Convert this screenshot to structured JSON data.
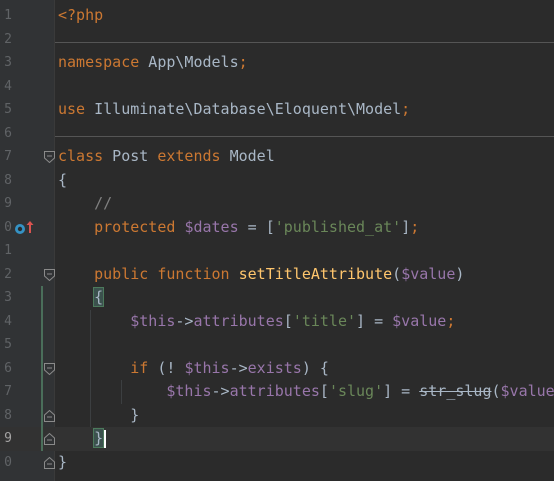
{
  "editor": {
    "colors": {
      "background": "#2b2b2b",
      "gutter": "#313335",
      "keyword": "#cc7832",
      "variable": "#9876aa",
      "string": "#6a8759",
      "comment": "#808080",
      "function": "#ffc66d",
      "plain": "#a9b7c6"
    },
    "lines": [
      {
        "num": "1",
        "tokens": [
          {
            "t": "<?php",
            "c": "kw"
          }
        ]
      },
      {
        "num": "2",
        "tokens": []
      },
      {
        "num": "3",
        "tokens": [
          {
            "t": "namespace",
            "c": "kw"
          },
          {
            "t": " App\\Models",
            "c": "plain"
          },
          {
            "t": ";",
            "c": "kw"
          }
        ]
      },
      {
        "num": "4",
        "tokens": []
      },
      {
        "num": "5",
        "tokens": [
          {
            "t": "use",
            "c": "kw"
          },
          {
            "t": " Illuminate\\Database\\Eloquent\\Model",
            "c": "plain"
          },
          {
            "t": ";",
            "c": "kw"
          }
        ]
      },
      {
        "num": "6",
        "tokens": []
      },
      {
        "num": "7",
        "tokens": [
          {
            "t": "class",
            "c": "kw"
          },
          {
            "t": " Post ",
            "c": "plain"
          },
          {
            "t": "extends",
            "c": "kw"
          },
          {
            "t": " Model",
            "c": "plain"
          }
        ]
      },
      {
        "num": "8",
        "tokens": [
          {
            "t": "{",
            "c": "plain"
          }
        ]
      },
      {
        "num": "9",
        "tokens": [
          {
            "t": "    ",
            "c": "plain"
          },
          {
            "t": "//",
            "c": "cmt"
          }
        ]
      },
      {
        "num": "0",
        "tokens": [
          {
            "t": "    ",
            "c": "plain"
          },
          {
            "t": "protected",
            "c": "kw"
          },
          {
            "t": " ",
            "c": "plain"
          },
          {
            "t": "$dates",
            "c": "var"
          },
          {
            "t": " = [",
            "c": "plain"
          },
          {
            "t": "'published_at'",
            "c": "str"
          },
          {
            "t": "]",
            "c": "plain"
          },
          {
            "t": ";",
            "c": "kw"
          }
        ]
      },
      {
        "num": "1",
        "tokens": []
      },
      {
        "num": "2",
        "tokens": [
          {
            "t": "    ",
            "c": "plain"
          },
          {
            "t": "public",
            "c": "kw"
          },
          {
            "t": " ",
            "c": "plain"
          },
          {
            "t": "function",
            "c": "kw"
          },
          {
            "t": " ",
            "c": "plain"
          },
          {
            "t": "setTitleAttribute",
            "c": "fn"
          },
          {
            "t": "(",
            "c": "plain"
          },
          {
            "t": "$value",
            "c": "var"
          },
          {
            "t": ")",
            "c": "plain"
          }
        ]
      },
      {
        "num": "3",
        "tokens": [
          {
            "t": "    ",
            "c": "plain"
          },
          {
            "t": "{",
            "c": "plain",
            "match": true
          }
        ]
      },
      {
        "num": "4",
        "tokens": [
          {
            "t": "        ",
            "c": "plain"
          },
          {
            "t": "$this",
            "c": "var"
          },
          {
            "t": "->",
            "c": "plain"
          },
          {
            "t": "attributes",
            "c": "var"
          },
          {
            "t": "[",
            "c": "plain"
          },
          {
            "t": "'title'",
            "c": "str"
          },
          {
            "t": "] = ",
            "c": "plain"
          },
          {
            "t": "$value",
            "c": "var"
          },
          {
            "t": ";",
            "c": "kw"
          }
        ]
      },
      {
        "num": "5",
        "tokens": []
      },
      {
        "num": "6",
        "tokens": [
          {
            "t": "        ",
            "c": "plain"
          },
          {
            "t": "if",
            "c": "kw"
          },
          {
            "t": " (! ",
            "c": "plain"
          },
          {
            "t": "$this",
            "c": "var"
          },
          {
            "t": "->",
            "c": "plain"
          },
          {
            "t": "exists",
            "c": "var"
          },
          {
            "t": ") {",
            "c": "plain"
          }
        ]
      },
      {
        "num": "7",
        "tokens": [
          {
            "t": "            ",
            "c": "plain"
          },
          {
            "t": "$this",
            "c": "var"
          },
          {
            "t": "->",
            "c": "plain"
          },
          {
            "t": "attributes",
            "c": "var"
          },
          {
            "t": "[",
            "c": "plain"
          },
          {
            "t": "'slug'",
            "c": "str"
          },
          {
            "t": "] = ",
            "c": "plain"
          },
          {
            "t": "str_slug",
            "c": "plain",
            "strike": true
          },
          {
            "t": "(",
            "c": "plain"
          },
          {
            "t": "$value",
            "c": "var"
          },
          {
            "t": ")",
            "c": "plain"
          },
          {
            "t": ";",
            "c": "kw"
          }
        ]
      },
      {
        "num": "8",
        "tokens": [
          {
            "t": "        ",
            "c": "plain"
          },
          {
            "t": "}",
            "c": "plain"
          }
        ]
      },
      {
        "num": "9",
        "tokens": [
          {
            "t": "    ",
            "c": "plain"
          },
          {
            "t": "}",
            "c": "plain",
            "match": true
          }
        ],
        "current": true
      },
      {
        "num": "0",
        "tokens": [
          {
            "t": "}",
            "c": "plain"
          }
        ]
      }
    ],
    "gutter_icons": {
      "implements_icon": "override-method-icon",
      "arrow_icon": "navigate-up-arrow-icon"
    }
  }
}
